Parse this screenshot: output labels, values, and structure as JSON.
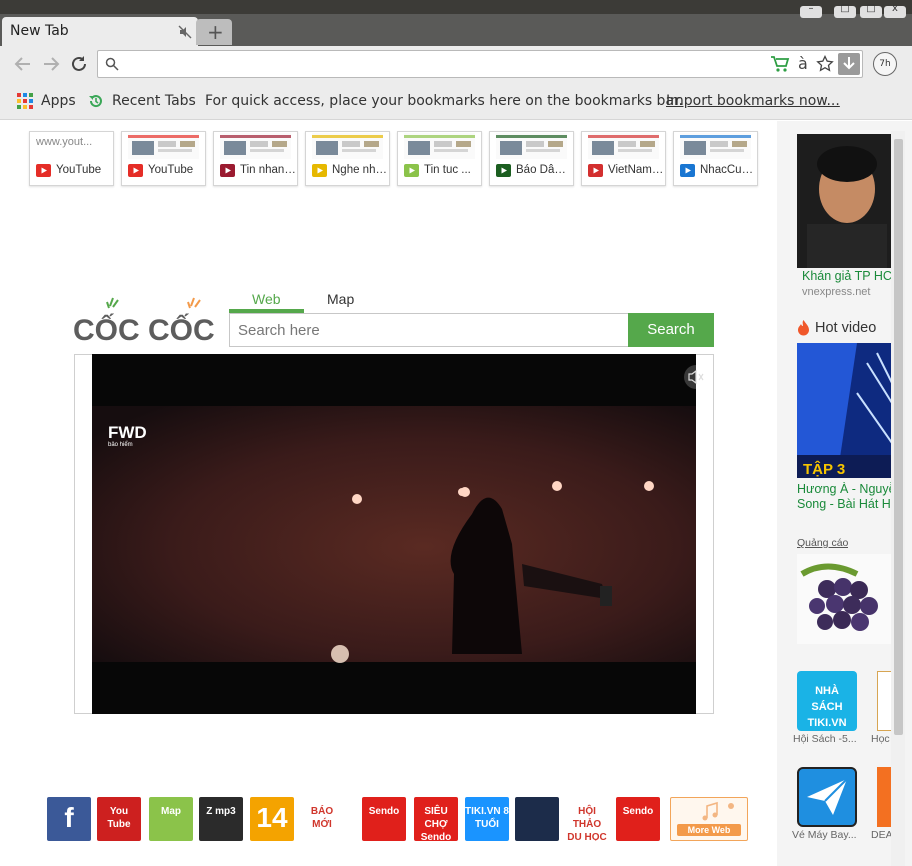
{
  "tab": {
    "title": "New Tab",
    "new_tab_symbol": "+"
  },
  "window_controls": [
    "–",
    "□",
    "x"
  ],
  "toolbar": {
    "address_value": "",
    "cart_icon": "shopping-cart-icon",
    "translate_glyph": "à",
    "profile_label": "7h"
  },
  "bookmarks_bar": {
    "apps_label": "Apps",
    "recent_label": "Recent Tabs",
    "hint": "For quick access, place your bookmarks here on the bookmarks bar.",
    "import_link": "Import bookmarks now..."
  },
  "speed_dial": [
    {
      "label": "YouTube",
      "preview_text": "www.yout...",
      "icon": "youtube-icon",
      "icon_color": "#e52d27"
    },
    {
      "label": "YouTube",
      "icon": "youtube-icon",
      "icon_color": "#e52d27"
    },
    {
      "label": "Tin nhanh...",
      "icon": "e-news-icon",
      "icon_color": "#9b1b30"
    },
    {
      "label": "Nghe nhạc...",
      "icon": "music-disc-icon",
      "icon_color": "#e6b800"
    },
    {
      "label": "Tin tuc ...",
      "icon": "clock-icon",
      "icon_color": "#8bc34a"
    },
    {
      "label": "Báo Dân trí",
      "icon": "d-news-icon",
      "icon_color": "#1b5e20"
    },
    {
      "label": "VietNamNet",
      "icon": "check-news-icon",
      "icon_color": "#d32f2f"
    },
    {
      "label": "NhacCuaTui",
      "icon": "headphone-icon",
      "icon_color": "#1976d2"
    }
  ],
  "search": {
    "logo_text": "CỐC CỐC",
    "tabs": [
      "Web",
      "Map"
    ],
    "placeholder": "Search here",
    "button_label": "Search",
    "accent": "#55a84b"
  },
  "video": {
    "brand": "FWD",
    "brand_sub": "bảo hiểm"
  },
  "bottom_icons": [
    {
      "name": "facebook",
      "text": "f",
      "bg": "#3b5998"
    },
    {
      "name": "youtube",
      "text": "You Tube",
      "bg": "#cd201f"
    },
    {
      "name": "map",
      "text": "Map",
      "bg": "#8bc34a"
    },
    {
      "name": "zing-mp3",
      "text": "Z mp3",
      "bg": "#2b2b2b"
    },
    {
      "name": "kenh14",
      "text": "14",
      "bg": "#f4a300"
    },
    {
      "name": "bao-moi",
      "text": "BÁO MỚI",
      "bg": "#ffffff"
    },
    {
      "name": "sendo",
      "text": "Sendo",
      "bg": "#e0201b"
    },
    {
      "name": "sieu-cho-sendo",
      "text": "SIÊU CHỢ Sendo",
      "bg": "#e0201b"
    },
    {
      "name": "tiki",
      "text": "TIKI.VN 8 TUỔI",
      "bg": "#1a94ff"
    },
    {
      "name": "game",
      "text": "",
      "bg": "#1c2c4a"
    },
    {
      "name": "du-hoc",
      "text": "HỘI THẢO DU HỌC",
      "bg": "#ffffff"
    },
    {
      "name": "sendo-2",
      "text": "Sendo",
      "bg": "#e0201b"
    }
  ],
  "more_web_label": "More Web",
  "sidebar": {
    "news_caption": "Khán giả TP HCM",
    "news_source": "vnexpress.net",
    "hot_video_title": "Hot video",
    "hot_video_badge": "TẬP 3",
    "hot_video_caption_1": "Hương À - Nguyễn",
    "hot_video_caption_2": "Song - Bài Hát Hay",
    "ad_label": "Quảng cáo",
    "tiki_caption": "Hội Sách -5...",
    "tiki_tile_text": "NHÀ SÁCH TIKI.VN",
    "hoc_caption": "Học",
    "flight_caption": "Vé Máy Bay...",
    "dea_caption": "DEA"
  }
}
